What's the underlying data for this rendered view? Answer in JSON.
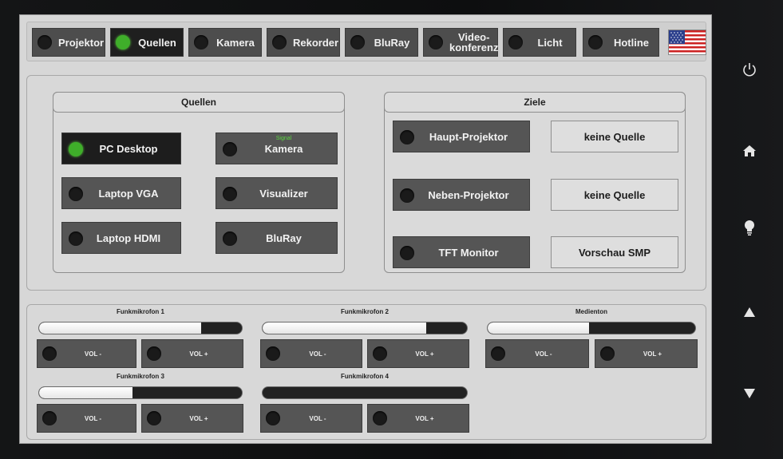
{
  "topbar": {
    "tabs": [
      {
        "label": "Projektor",
        "active": false
      },
      {
        "label": "Quellen",
        "active": true
      },
      {
        "label": "Kamera",
        "active": false
      },
      {
        "label": "Rekorder",
        "active": false
      },
      {
        "label": "BluRay",
        "active": false
      },
      {
        "label": "Video-\nkonferenz",
        "active": false
      },
      {
        "label": "Licht",
        "active": false
      },
      {
        "label": "Hotline",
        "active": false
      }
    ],
    "flag_icon": "us-flag-icon"
  },
  "sources": {
    "title": "Quellen",
    "buttons": [
      {
        "label": "PC Desktop",
        "active": true
      },
      {
        "label": "Kamera",
        "active": false,
        "signal": "Signal"
      },
      {
        "label": "Laptop VGA",
        "active": false
      },
      {
        "label": "Visualizer",
        "active": false
      },
      {
        "label": "Laptop HDMI",
        "active": false
      },
      {
        "label": "BluRay",
        "active": false
      }
    ]
  },
  "targets": {
    "title": "Ziele",
    "rows": [
      {
        "label": "Haupt-Projektor",
        "source": "keine Quelle"
      },
      {
        "label": "Neben-Projektor",
        "source": "keine Quelle"
      },
      {
        "label": "TFT Monitor",
        "source": "Vorschau SMP"
      }
    ]
  },
  "audio": {
    "channels": [
      {
        "label": "Funkmikrofon 1",
        "level": 0.8,
        "vol_minus": "VOL -",
        "vol_plus": "VOL +"
      },
      {
        "label": "Funkmikrofon 2",
        "level": 0.8,
        "vol_minus": "VOL -",
        "vol_plus": "VOL +"
      },
      {
        "label": "Medienton",
        "level": 0.49,
        "vol_minus": "VOL -",
        "vol_plus": "VOL +"
      },
      {
        "label": "Funkmikrofon 3",
        "level": 0.46,
        "vol_minus": "VOL -",
        "vol_plus": "VOL +"
      },
      {
        "label": "Funkmikrofon 4",
        "level": 0.0,
        "vol_minus": "VOL -",
        "vol_plus": "VOL +"
      }
    ]
  },
  "side_buttons": [
    "power-icon",
    "home-icon",
    "lightbulb-icon",
    "arrow-up-icon",
    "arrow-down-icon"
  ],
  "colors": {
    "led_on": "#3fae2a",
    "button": "#555555",
    "button_active": "#1d1d1d",
    "panel": "#d8d8d8"
  }
}
